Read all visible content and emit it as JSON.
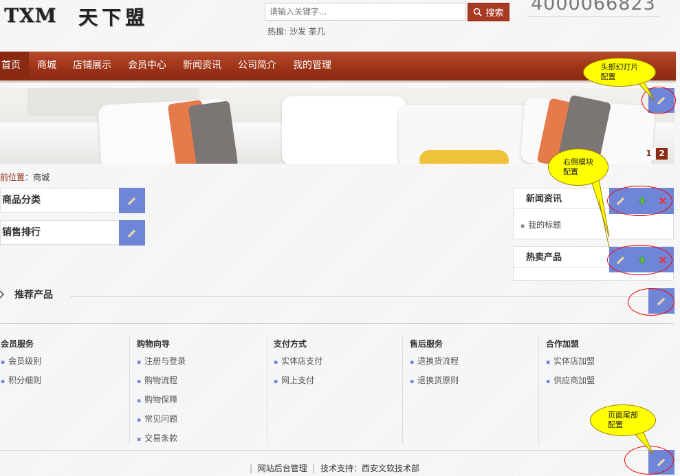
{
  "header": {
    "logo_latin": "TXM",
    "logo_cjk": "天下盟",
    "search_placeholder": "请输入关键字...",
    "search_button": "搜索",
    "hot_label": "热搜:",
    "hot_items": [
      "沙发",
      "茶几"
    ],
    "phone": "4000066823"
  },
  "nav": {
    "items": [
      "首页",
      "商城",
      "店铺展示",
      "会员中心",
      "新闻资讯",
      "公司简介",
      "我的管理"
    ],
    "active_index": 0
  },
  "banner": {
    "pages": [
      "1",
      "2"
    ],
    "active_page": 2
  },
  "breadcrumb": {
    "label": "前位置",
    "current": "商城"
  },
  "left_modules": [
    "商品分类",
    "销售排行"
  ],
  "right_modules": [
    {
      "title": "新闻资讯",
      "items": [
        "我的标题"
      ]
    },
    {
      "title": "热卖产品",
      "items": []
    }
  ],
  "recommended": {
    "title": "推荐产品"
  },
  "footer_columns": [
    {
      "title": "会员服务",
      "items": [
        "会员级别",
        "积分细则"
      ]
    },
    {
      "title": "购物向导",
      "items": [
        "注册与登录",
        "购物流程",
        "购物保障",
        "常见问题",
        "交易条款"
      ]
    },
    {
      "title": "支付方式",
      "items": [
        "实体店支付",
        "网上支付"
      ]
    },
    {
      "title": "售后服务",
      "items": [
        "退换货流程",
        "退换货原则"
      ]
    },
    {
      "title": "合作加盟",
      "items": [
        "实体店加盟",
        "供应商加盟"
      ]
    }
  ],
  "footer_links": {
    "admin": "网站后台管理",
    "support": "技术支持：西安文软技术部"
  },
  "callouts": {
    "slider": [
      "头部幻灯片",
      "配置"
    ],
    "right": [
      "右侧模块",
      "配置"
    ],
    "footer": [
      "页面尾部",
      "配置"
    ]
  },
  "colors": {
    "nav": "#9c3217",
    "edit": "#6f86d8",
    "callout": "#ffff00",
    "ring": "#e00000"
  }
}
